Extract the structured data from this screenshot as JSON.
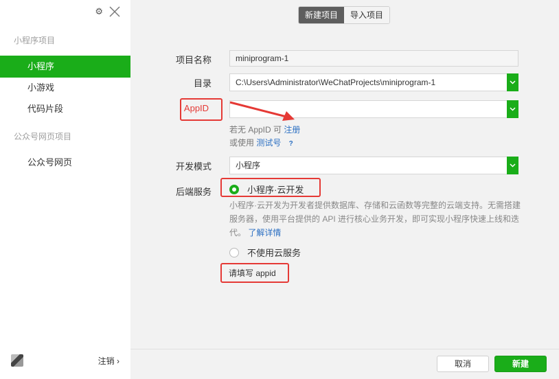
{
  "sidebar": {
    "section_miniprogram": "小程序项目",
    "items": [
      {
        "label": "小程序",
        "active": true
      },
      {
        "label": "小游戏",
        "active": false
      },
      {
        "label": "代码片段",
        "active": false
      }
    ],
    "section_official": "公众号网页项目",
    "official_items": [
      {
        "label": "公众号网页"
      }
    ],
    "logout_label": "注销",
    "logout_chevron": "›"
  },
  "top_icons": {
    "gear": "gear-icon",
    "close": "close-icon"
  },
  "tabs": [
    {
      "label": "新建项目",
      "active": true
    },
    {
      "label": "导入项目",
      "active": false
    }
  ],
  "form": {
    "name_label": "项目名称",
    "name_value": "miniprogram-1",
    "dir_label": "目录",
    "dir_value": "C:\\Users\\Administrator\\WeChatProjects\\miniprogram-1",
    "appid_label": "AppID",
    "appid_value": "",
    "hint1_prefix": "若无 AppID 可",
    "hint1_link": "注册",
    "hint2_prefix": "或使用",
    "hint2_link": "测试号",
    "hint2_q": "?",
    "mode_label": "开发模式",
    "mode_value": "小程序",
    "backend_label": "后端服务",
    "cloud_option": "小程序·云开发",
    "cloud_desc": "小程序·云开发为开发者提供数据库、存储和云函数等完整的云端支持。无需搭建服务器，使用平台提供的 API 进行核心业务开发，即可实现小程序快速上线和迭代。",
    "cloud_link": "了解详情",
    "no_cloud_option": "不使用云服务",
    "warning": "请填写 appid"
  },
  "footer": {
    "cancel_label": "取消",
    "create_label": "新建"
  },
  "colors": {
    "accent": "#1aad19",
    "annotation": "#e53935",
    "link": "#2b6fc2"
  }
}
